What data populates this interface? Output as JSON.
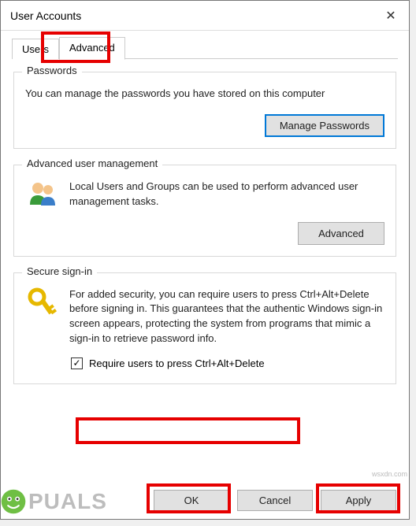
{
  "window": {
    "title": "User Accounts"
  },
  "tabs": {
    "users": "Users",
    "advanced": "Advanced",
    "active": "advanced"
  },
  "passwords": {
    "legend": "Passwords",
    "text": "You can manage the passwords you have stored on this computer",
    "button": "Manage Passwords"
  },
  "aum": {
    "legend": "Advanced user management",
    "text": "Local Users and Groups can be used to perform advanced user management tasks.",
    "button": "Advanced"
  },
  "secure": {
    "legend": "Secure sign-in",
    "text": "For added security, you can require users to press Ctrl+Alt+Delete before signing in. This guarantees that the authentic Windows sign-in screen appears, protecting the system from programs that mimic a sign-in to retrieve password info.",
    "checkbox_label": "Require users to press Ctrl+Alt+Delete",
    "checkbox_checked": true
  },
  "footer": {
    "ok": "OK",
    "cancel": "Cancel",
    "apply": "Apply"
  },
  "icons": {
    "close": "✕",
    "check": "✓"
  },
  "watermark": {
    "site": "wsxdn.com",
    "brand": "PUALS"
  }
}
